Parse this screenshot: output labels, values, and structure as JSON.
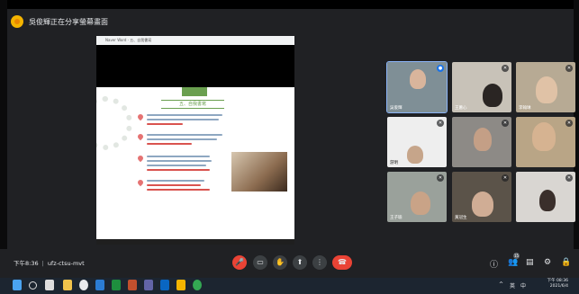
{
  "meeting": {
    "title": "吳俊輝正在分享螢幕畫面",
    "time": "下午8:36",
    "code": "ufz-ctsu-mvt"
  },
  "slide": {
    "title": "五、自我書寫",
    "browser_tab": "Naver Word · 五、自我書寫"
  },
  "participants": [
    {
      "name": "吳俊輝",
      "mic": "active"
    },
    {
      "name": "王蕙心",
      "mic": "muted"
    },
    {
      "name": "李翰琳",
      "mic": "muted"
    },
    {
      "name": "游明",
      "mic": "muted"
    },
    {
      "name": "",
      "mic": "muted"
    },
    {
      "name": "",
      "mic": "muted"
    },
    {
      "name": "王子瑜",
      "mic": "muted"
    },
    {
      "name": "黃冠生",
      "mic": "muted"
    },
    {
      "name": "",
      "mic": "muted"
    }
  ],
  "controls": {
    "mic": "🎤",
    "camera": "▭",
    "hand": "✋",
    "present": "⬆",
    "more": "⋮",
    "end": "☎"
  },
  "right_controls": {
    "info": "ⓘ",
    "people": "👥",
    "people_count": "15",
    "chat": "▤",
    "activities": "⚙",
    "lock": "🔒"
  },
  "taskbar": {
    "clock_time": "下午 08:36",
    "clock_date": "2021/6/4",
    "lang": "英",
    "lang2": "中"
  },
  "colors": {
    "accent": "#8ab4f8",
    "danger": "#ea4335",
    "slide_green": "#6a9f4f"
  }
}
